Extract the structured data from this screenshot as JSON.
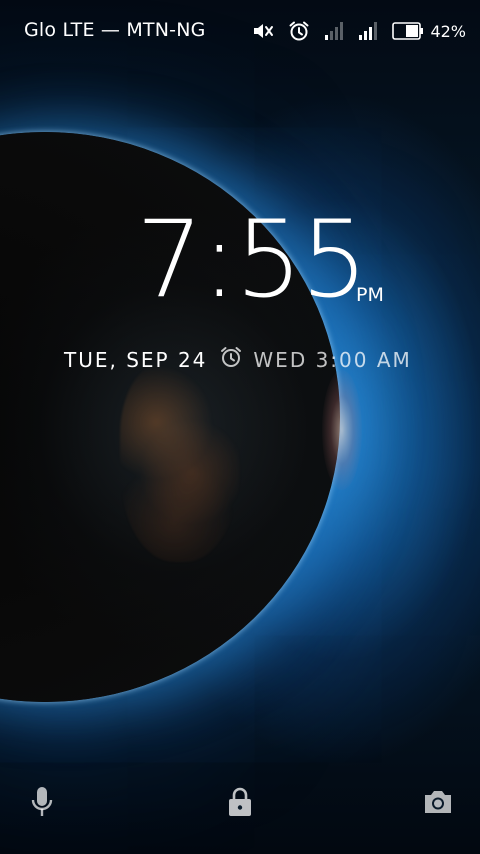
{
  "status_bar": {
    "carrier": "Glo LTE — MTN-NG",
    "battery_percent": "42%",
    "icons": [
      "muted-speaker-icon",
      "alarm-icon",
      "signal-weak-icon",
      "signal-strong-icon",
      "battery-icon"
    ]
  },
  "clock": {
    "time": "7:55",
    "ampm": "PM"
  },
  "date": {
    "current": "TUE, SEP 24",
    "next_alarm": "WED 3:00 AM"
  },
  "shortcuts": {
    "left": "microphone-icon",
    "center": "lock-icon",
    "right": "camera-icon"
  },
  "colors": {
    "text": "#ffffff",
    "accent_glow": "#2a8cd2"
  }
}
